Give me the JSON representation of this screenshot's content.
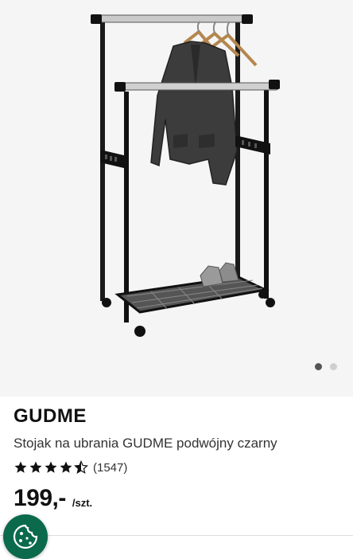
{
  "gallery": {
    "image_alt": "GUDME clothes rack with jacket, hangers and shoes",
    "slides": 2,
    "active_slide": 1
  },
  "product": {
    "brand": "GUDME",
    "description": "Stojak na ubrania GUDME podwójny czarny",
    "rating": 4.5,
    "rating_count": "(1547)",
    "price": "199,-",
    "unit": "/szt."
  },
  "icons": {
    "star": "star-icon",
    "cookie": "cookie-icon"
  },
  "colors": {
    "cookie_bg": "#0a6a4b",
    "star": "#111111"
  }
}
